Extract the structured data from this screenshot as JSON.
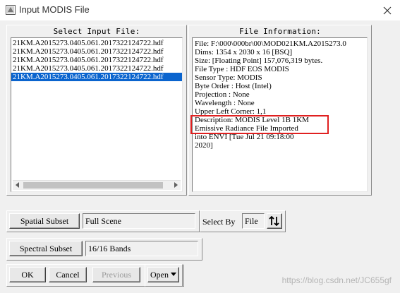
{
  "window": {
    "title": "Input MODIS File",
    "app_icon": "envi-app-icon",
    "close_icon": "close-icon"
  },
  "select_input": {
    "label": "Select Input File:",
    "files": [
      "21KM.A2015273.0405.061.2017322124722.hdf",
      "21KM.A2015273.0405.061.2017322124722.hdf",
      "21KM.A2015273.0405.061.2017322124722.hdf",
      "21KM.A2015273.0405.061.2017322124722.hdf",
      "21KM.A2015273.0405.061.2017322124722.hdf"
    ],
    "selected_index": 4
  },
  "file_info": {
    "label": "File Information:",
    "lines": [
      "File: F:\\000\\000br\\00\\MOD021KM.A2015273.0",
      "Dims: 1354 x 2030 x 16 [BSQ]",
      "Size: [Floating Point] 157,076,319 bytes.",
      "File Type  : HDF EOS MODIS",
      "Sensor Type: MODIS",
      "Byte Order : Host (Intel)",
      "Projection : None",
      "Wavelength : None",
      "Upper Left Corner: 1,1",
      "Description: MODIS Level 1B 1KM",
      "Emissive Radiance File Imported",
      "into ENVI [Tue Jul 21 09:18:00",
      "2020]"
    ]
  },
  "spatial_subset": {
    "button_label": "Spatial Subset",
    "value": "Full Scene"
  },
  "select_by": {
    "label": "Select By",
    "value": "File",
    "sort_icon": "sort-arrows-icon"
  },
  "spectral_subset": {
    "button_label": "Spectral Subset",
    "value": "16/16 Bands"
  },
  "footer_buttons": {
    "ok": "OK",
    "cancel": "Cancel",
    "previous": "Previous",
    "open": "Open"
  },
  "watermark": "https://blog.csdn.net/JC655gf",
  "colors": {
    "selection": "#0a64ce",
    "highlight": "#e02020"
  }
}
